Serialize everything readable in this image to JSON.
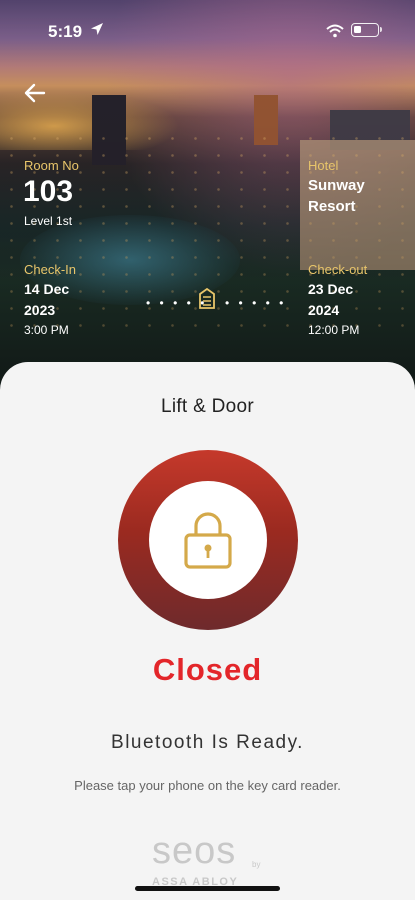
{
  "status_bar": {
    "time": "5:19",
    "icons": [
      "location-arrow-icon",
      "wifi-icon",
      "battery-icon"
    ]
  },
  "header": {
    "back_icon": "back-arrow-icon",
    "room": {
      "label": "Room No",
      "number": "103",
      "level": "Level 1st"
    },
    "hotel": {
      "label": "Hotel",
      "name_line1": "Sunway",
      "name_line2": "Resort"
    },
    "check_in": {
      "label": "Check-In",
      "date_line1": "14 Dec",
      "date_line2": "2023",
      "time": "3:00 PM"
    },
    "check_out": {
      "label": "Check-out",
      "date_line1": "23 Dec",
      "date_line2": "2024",
      "time": "12:00 PM"
    },
    "separator_dots": "• • • • •",
    "building_icon": "building-icon"
  },
  "sheet": {
    "title": "Lift & Door",
    "lock_icon": "padlock-icon",
    "status": "Closed",
    "bluetooth_message": "Bluetooth Is Ready.",
    "hint": "Please tap your phone on the key card reader.",
    "logo": {
      "word": "seos",
      "by": "by",
      "sub": "ASSA ABLOY"
    }
  },
  "colors": {
    "accent_gold": "#e8c56a",
    "status_red": "#e3262a",
    "ring_top": "#c5392b",
    "ring_bottom": "#6e2a2c",
    "sheet_bg": "#f4f4f4"
  }
}
